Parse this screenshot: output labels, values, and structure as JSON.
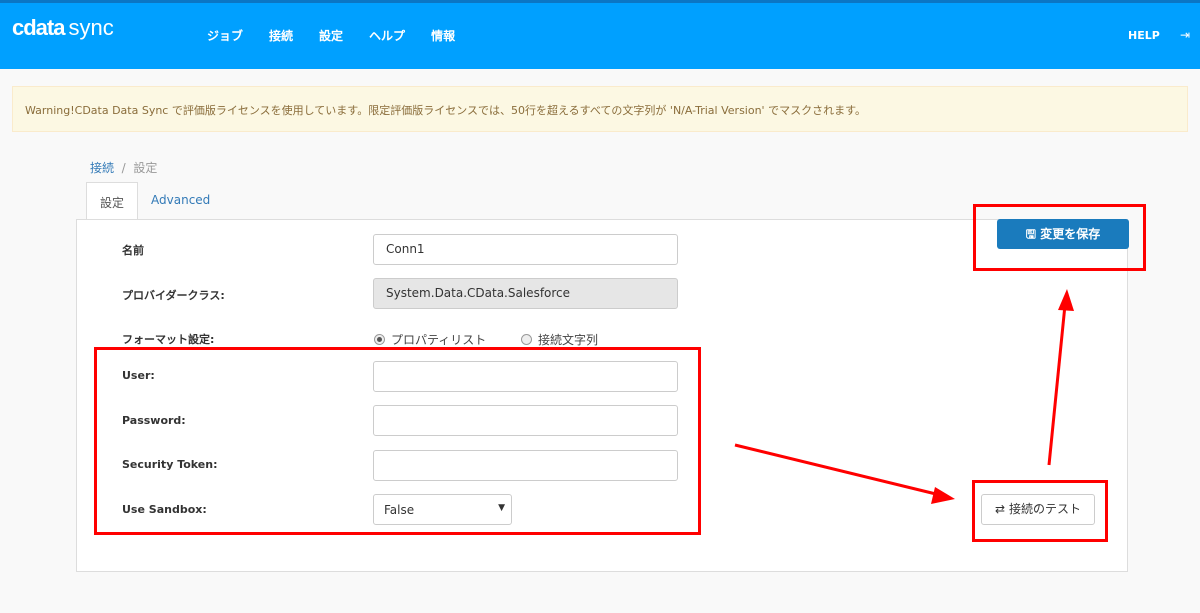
{
  "nav": {
    "logo_a": "cdata",
    "logo_b": "sync",
    "menu": [
      "ジョブ",
      "接続",
      "設定",
      "ヘルプ",
      "情報"
    ],
    "help": "HELP"
  },
  "warning": "Warning!CData Data Sync で評価版ライセンスを使用しています。限定評価版ライセンスでは、50行を超えるすべての文字列が 'N/A-Trial Version' でマスクされます。",
  "breadcrumb": {
    "parent": "接続",
    "current": "設定"
  },
  "tabs": [
    "設定",
    "Advanced"
  ],
  "form": {
    "name_label": "名前",
    "name_value": "Conn1",
    "provider_label": "プロバイダークラス:",
    "provider_value": "System.Data.CData.Salesforce",
    "format_label": "フォーマット設定:",
    "format_options": [
      "プロパティリスト",
      "接続文字列"
    ],
    "user_label": "User:",
    "password_label": "Password:",
    "token_label": "Security Token:",
    "sandbox_label": "Use Sandbox:",
    "sandbox_value": "False"
  },
  "buttons": {
    "save": "変更を保存",
    "test": "接続のテスト"
  },
  "colors": {
    "nav": "#00a0ff",
    "annotation": "#ff0000",
    "primary": "#1a7bbd"
  }
}
